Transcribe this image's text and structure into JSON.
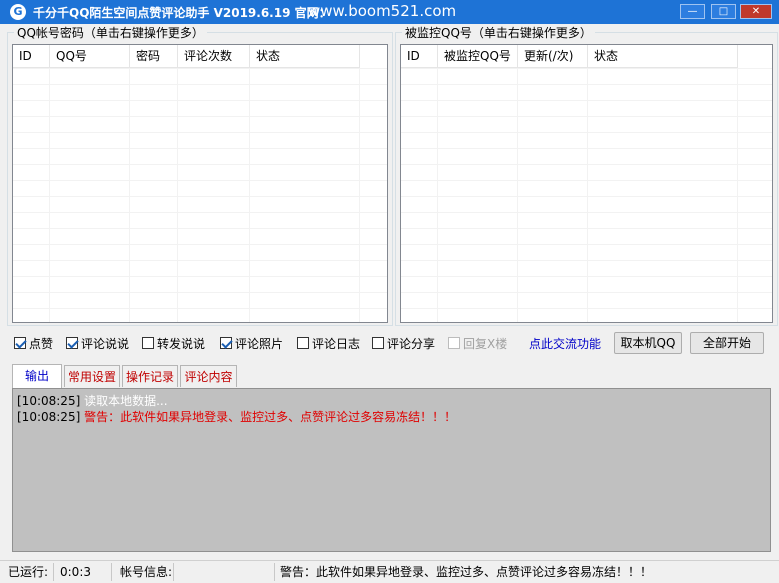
{
  "window": {
    "title": "千分千QQ陌生空间点赞评论助手 V2019.6.19 官网：",
    "url": "www.boom521.com",
    "icon": "G"
  },
  "left_panel": {
    "title": "QQ帐号密码（单击右键操作更多）",
    "columns": [
      "ID",
      "QQ号",
      "密码",
      "评论次数",
      "状态"
    ]
  },
  "right_panel": {
    "title": "被监控QQ号（单击右键操作更多）",
    "columns": [
      "ID",
      "被监控QQ号",
      "更新(/次)",
      "状态"
    ]
  },
  "options": [
    {
      "label": "点赞",
      "checked": true,
      "disabled": false
    },
    {
      "label": "评论说说",
      "checked": true,
      "disabled": false
    },
    {
      "label": "转发说说",
      "checked": false,
      "disabled": false
    },
    {
      "label": "评论照片",
      "checked": true,
      "disabled": false
    },
    {
      "label": "评论日志",
      "checked": false,
      "disabled": false
    },
    {
      "label": "评论分享",
      "checked": false,
      "disabled": false
    },
    {
      "label": "回复X楼",
      "checked": false,
      "disabled": true
    }
  ],
  "link_label": "点此交流功能",
  "buttons": {
    "get_qq": "取本机QQ",
    "start_all": "全部开始"
  },
  "tabs": [
    "输出",
    "常用设置",
    "操作记录",
    "评论内容"
  ],
  "log": [
    {
      "time": "[10:08:25]",
      "text": "读取本地数据...",
      "color": "#ffffff"
    },
    {
      "time": "[10:08:25]",
      "text": "警告：此软件如果异地登录、监控过多、点赞评论过多容易冻结！！！",
      "color": "#e00000"
    }
  ],
  "status": {
    "running_label": "已运行:",
    "running_value": "0:0:3",
    "account_label": "帐号信息:",
    "account_value": "",
    "message": "警告：此软件如果异地登录、监控过多、点赞评论过多容易冻结！！！"
  },
  "colors": {
    "titlebar": "#1e73d6",
    "link": "#0000c8",
    "warning": "#e00000",
    "log_bg": "#c0c0c0"
  }
}
